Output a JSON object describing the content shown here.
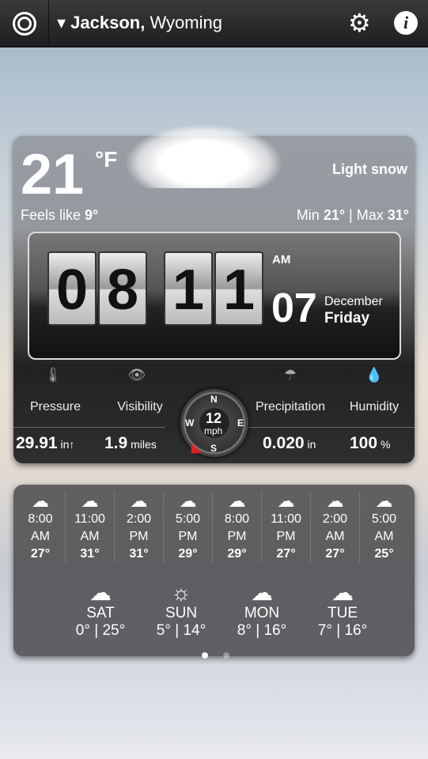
{
  "header": {
    "city": "Jackson,",
    "region": "Wyoming"
  },
  "current": {
    "temp": "21",
    "unit": "°F",
    "condition": "Light snow",
    "feels_label": "Feels like",
    "feels": "9°",
    "min_label": "Min",
    "min": "21°",
    "max_label": "Max",
    "max": "31°"
  },
  "clock": {
    "h1": "0",
    "h2": "8",
    "m1": "1",
    "m2": "1",
    "ampm": "AM",
    "day": "07",
    "month": "December",
    "weekday": "Friday"
  },
  "stats": [
    {
      "label": "Pressure",
      "value": "29.91",
      "unit": "in↑",
      "icon": "thermometer-icon",
      "glyph": "🌡"
    },
    {
      "label": "Visibility",
      "value": "1.9",
      "unit": "miles",
      "icon": "eye-icon",
      "glyph": "👁"
    },
    {
      "label": "Precipitation",
      "value": "0.020",
      "unit": "in",
      "icon": "umbrella-icon",
      "glyph": "☂"
    },
    {
      "label": "Humidity",
      "value": "100",
      "unit": "%",
      "icon": "drops-icon",
      "glyph": "💧"
    }
  ],
  "wind": {
    "speed": "12",
    "unit": "mph",
    "n": "N",
    "e": "E",
    "s": "S",
    "w": "W"
  },
  "hourly": [
    {
      "time": "8:00",
      "ampm": "AM",
      "temp": "27°",
      "icon": "☁"
    },
    {
      "time": "11:00",
      "ampm": "AM",
      "temp": "31°",
      "icon": "☁"
    },
    {
      "time": "2:00",
      "ampm": "PM",
      "temp": "31°",
      "icon": "☁"
    },
    {
      "time": "5:00",
      "ampm": "PM",
      "temp": "29°",
      "icon": "☁"
    },
    {
      "time": "8:00",
      "ampm": "PM",
      "temp": "29°",
      "icon": "☁"
    },
    {
      "time": "11:00",
      "ampm": "PM",
      "temp": "27°",
      "icon": "☁"
    },
    {
      "time": "2:00",
      "ampm": "AM",
      "temp": "27°",
      "icon": "☁"
    },
    {
      "time": "5:00",
      "ampm": "AM",
      "temp": "25°",
      "icon": "☁"
    }
  ],
  "daily": [
    {
      "day": "SAT",
      "low": "0°",
      "high": "25°",
      "icon": "☁"
    },
    {
      "day": "SUN",
      "low": "5°",
      "high": "14°",
      "icon": "☼"
    },
    {
      "day": "MON",
      "low": "8°",
      "high": "16°",
      "icon": "☁"
    },
    {
      "day": "TUE",
      "low": "7°",
      "high": "16°",
      "icon": "☁"
    }
  ],
  "page": {
    "current": 1,
    "total": 2
  }
}
